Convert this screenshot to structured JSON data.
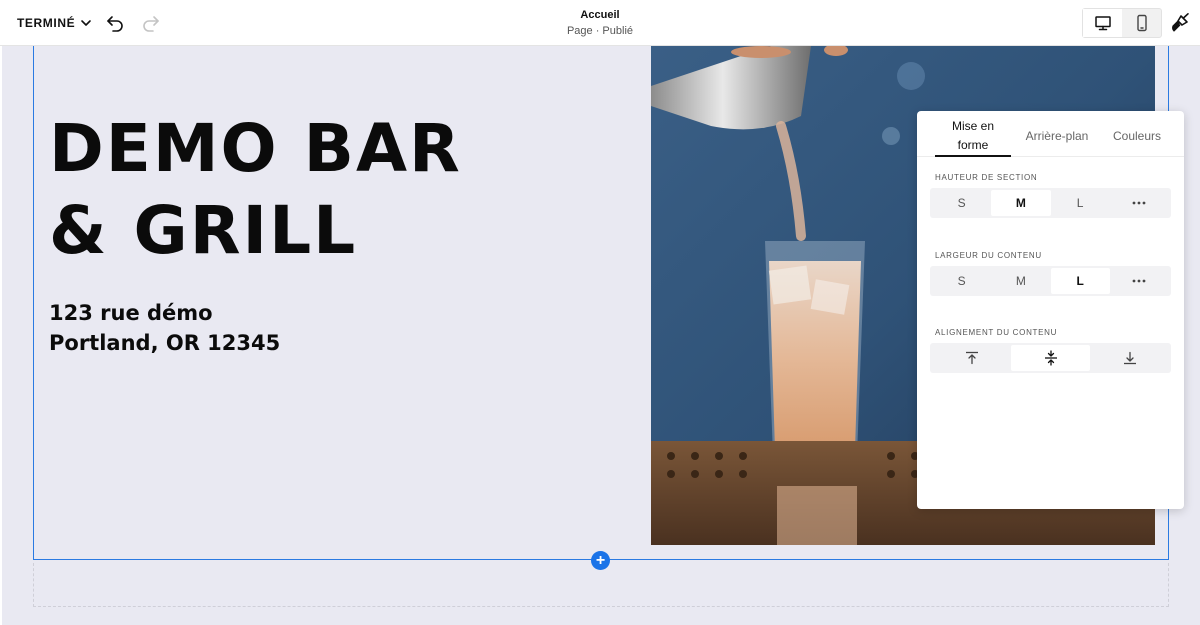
{
  "topbar": {
    "done_label": "TERMINÉ",
    "page_title": "Accueil",
    "page_subtitle": "Page · Publié"
  },
  "hero": {
    "title_line1": "DEMO BAR",
    "title_line2": "& GRILL",
    "address_line1": "123 rue démo",
    "address_line2": "Portland, OR 12345"
  },
  "panel": {
    "tabs": [
      {
        "label": "Mise en forme",
        "active": true
      },
      {
        "label": "Arrière-plan",
        "active": false
      },
      {
        "label": "Couleurs",
        "active": false
      }
    ],
    "section_height": {
      "label": "HAUTEUR DE SECTION",
      "options": [
        "S",
        "M",
        "L"
      ],
      "selected": "M"
    },
    "content_width": {
      "label": "LARGEUR DU CONTENU",
      "options": [
        "S",
        "M",
        "L"
      ],
      "selected": "L"
    },
    "content_alignment": {
      "label": "ALIGNEMENT DU CONTENU",
      "options": [
        "align-top-icon",
        "align-middle-icon",
        "align-bottom-icon"
      ],
      "selected": "align-middle-icon"
    }
  },
  "colors": {
    "accent": "#1a73e8",
    "section_border": "#2a7ae2",
    "canvas_bg": "#e9e9f2"
  }
}
